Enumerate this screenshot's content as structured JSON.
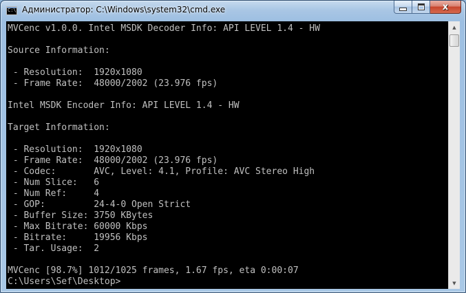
{
  "window": {
    "title": "Администратор: C:\\Windows\\system32\\cmd.exe",
    "icon_text": "C:\\",
    "close_label": "x",
    "scroll_up_label": "▲",
    "scroll_down_label": "▼"
  },
  "console": {
    "lines": [
      "MVCenc v1.0.0. Intel MSDK Decoder Info: API LEVEL 1.4 - HW",
      "",
      "Source Information:",
      "",
      " - Resolution:  1920x1080",
      " - Frame Rate:  48000/2002 (23.976 fps)",
      "",
      "Intel MSDK Encoder Info: API LEVEL 1.4 - HW",
      "",
      "Target Information:",
      "",
      " - Resolution:  1920x1080",
      " - Frame Rate:  48000/2002 (23.976 fps)",
      " - Codec:       AVC, Level: 4.1, Profile: AVC Stereo High",
      " - Num Slice:   6",
      " - Num Ref:     4",
      " - GOP:         24-4-0 Open Strict",
      " - Buffer Size: 3750 KBytes",
      " - Max Bitrate: 60000 Kbps",
      " - Bitrate:     19956 Kbps",
      " - Tar. Usage:  2",
      "",
      "MVCenc [98.7%] 1012/1025 frames, 1.67 fps, eta 0:00:07",
      "C:\\Users\\Sef\\Desktop>"
    ]
  },
  "scrollbar": {
    "position": 0.0
  },
  "colors": {
    "console_background": "#000000",
    "console_text": "#c0c0c0"
  }
}
